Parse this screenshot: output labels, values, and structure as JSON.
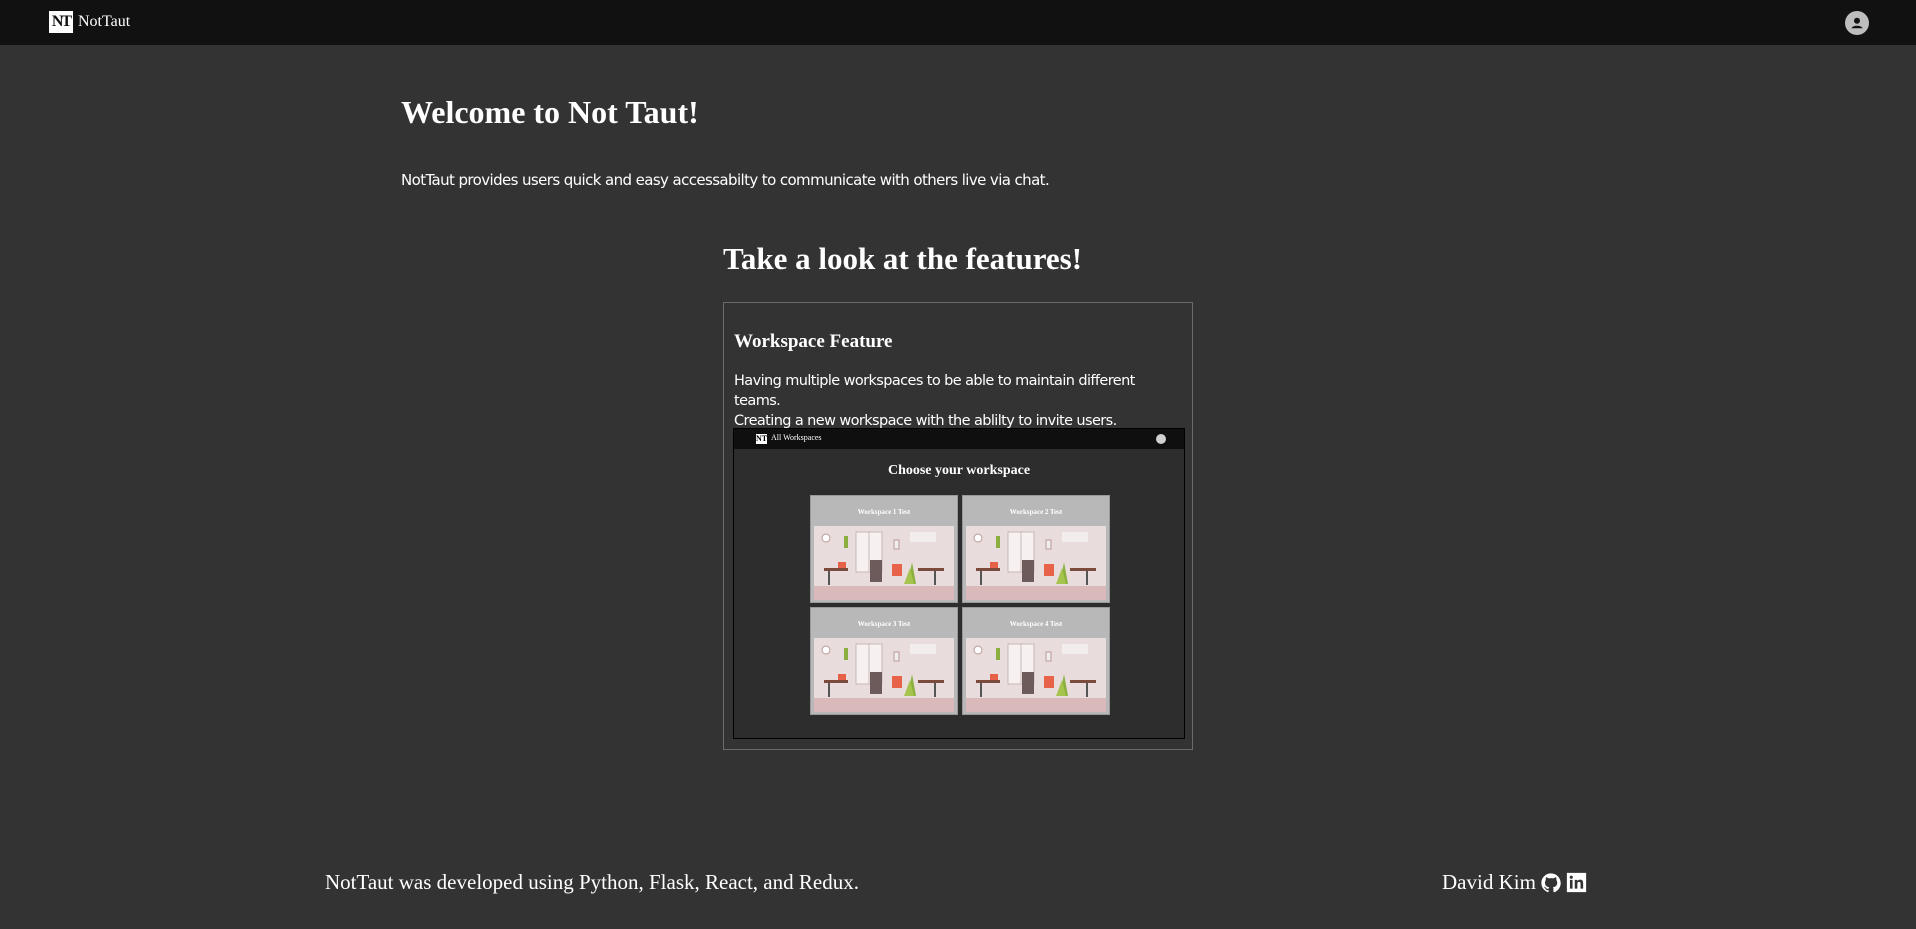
{
  "nav": {
    "logo_text": "NT",
    "brand": "NotTaut",
    "user_icon": "account-circle-icon"
  },
  "main": {
    "welcome_title": "Welcome to Not Taut!",
    "intro": "NotTaut provides users quick and easy accessabilty to communicate with others live via chat.",
    "features_title": "Take a look at the features!"
  },
  "feature": {
    "name": "Workspace Feature",
    "desc_line1": "Having multiple workspaces to be able to maintain different teams.",
    "desc_line2": "Creating a new workspace with the ablilty to invite users.",
    "preview": {
      "bar_title": "All Workspaces",
      "heading": "Choose your workspace",
      "workspaces": [
        "Workspace 1 Test",
        "Workspace 2 Test",
        "Workspace 3 Test",
        "Workspace 4 Test"
      ]
    }
  },
  "footer": {
    "tech": "NotTaut was developed using Python, Flask, React, and Redux.",
    "author": "David Kim",
    "github_icon": "github-icon",
    "linkedin_icon": "linkedin-icon"
  },
  "colors": {
    "background": "#333333",
    "topbar": "#111111",
    "text": "#ffffff",
    "tile": "#b8b8b8"
  }
}
